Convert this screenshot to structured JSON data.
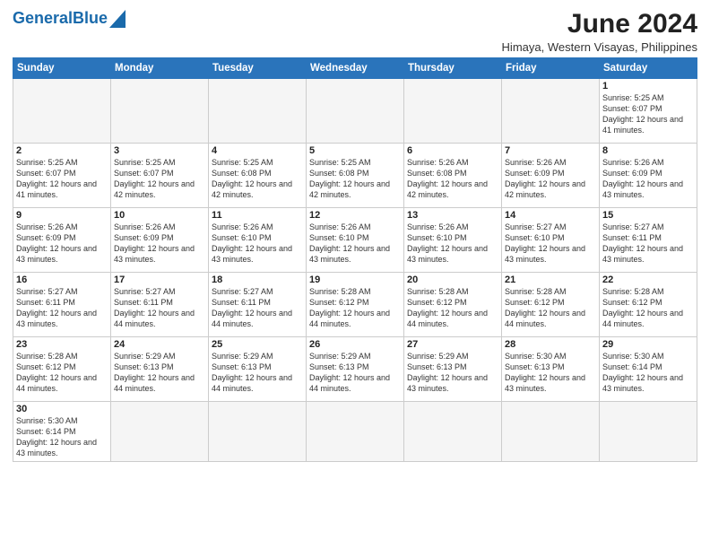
{
  "header": {
    "logo_general": "General",
    "logo_blue": "Blue",
    "title": "June 2024",
    "subtitle": "Himaya, Western Visayas, Philippines"
  },
  "weekdays": [
    "Sunday",
    "Monday",
    "Tuesday",
    "Wednesday",
    "Thursday",
    "Friday",
    "Saturday"
  ],
  "weeks": [
    [
      {
        "day": "",
        "empty": true
      },
      {
        "day": "",
        "empty": true
      },
      {
        "day": "",
        "empty": true
      },
      {
        "day": "",
        "empty": true
      },
      {
        "day": "",
        "empty": true
      },
      {
        "day": "",
        "empty": true
      },
      {
        "day": "1",
        "sunrise": "Sunrise: 5:25 AM",
        "sunset": "Sunset: 6:07 PM",
        "daylight": "Daylight: 12 hours and 41 minutes."
      }
    ],
    [
      {
        "day": "2",
        "sunrise": "Sunrise: 5:25 AM",
        "sunset": "Sunset: 6:07 PM",
        "daylight": "Daylight: 12 hours and 41 minutes."
      },
      {
        "day": "3",
        "sunrise": "Sunrise: 5:25 AM",
        "sunset": "Sunset: 6:07 PM",
        "daylight": "Daylight: 12 hours and 42 minutes."
      },
      {
        "day": "4",
        "sunrise": "Sunrise: 5:25 AM",
        "sunset": "Sunset: 6:08 PM",
        "daylight": "Daylight: 12 hours and 42 minutes."
      },
      {
        "day": "5",
        "sunrise": "Sunrise: 5:25 AM",
        "sunset": "Sunset: 6:08 PM",
        "daylight": "Daylight: 12 hours and 42 minutes."
      },
      {
        "day": "6",
        "sunrise": "Sunrise: 5:26 AM",
        "sunset": "Sunset: 6:08 PM",
        "daylight": "Daylight: 12 hours and 42 minutes."
      },
      {
        "day": "7",
        "sunrise": "Sunrise: 5:26 AM",
        "sunset": "Sunset: 6:09 PM",
        "daylight": "Daylight: 12 hours and 42 minutes."
      },
      {
        "day": "8",
        "sunrise": "Sunrise: 5:26 AM",
        "sunset": "Sunset: 6:09 PM",
        "daylight": "Daylight: 12 hours and 43 minutes."
      }
    ],
    [
      {
        "day": "9",
        "sunrise": "Sunrise: 5:26 AM",
        "sunset": "Sunset: 6:09 PM",
        "daylight": "Daylight: 12 hours and 43 minutes."
      },
      {
        "day": "10",
        "sunrise": "Sunrise: 5:26 AM",
        "sunset": "Sunset: 6:09 PM",
        "daylight": "Daylight: 12 hours and 43 minutes."
      },
      {
        "day": "11",
        "sunrise": "Sunrise: 5:26 AM",
        "sunset": "Sunset: 6:10 PM",
        "daylight": "Daylight: 12 hours and 43 minutes."
      },
      {
        "day": "12",
        "sunrise": "Sunrise: 5:26 AM",
        "sunset": "Sunset: 6:10 PM",
        "daylight": "Daylight: 12 hours and 43 minutes."
      },
      {
        "day": "13",
        "sunrise": "Sunrise: 5:26 AM",
        "sunset": "Sunset: 6:10 PM",
        "daylight": "Daylight: 12 hours and 43 minutes."
      },
      {
        "day": "14",
        "sunrise": "Sunrise: 5:27 AM",
        "sunset": "Sunset: 6:10 PM",
        "daylight": "Daylight: 12 hours and 43 minutes."
      },
      {
        "day": "15",
        "sunrise": "Sunrise: 5:27 AM",
        "sunset": "Sunset: 6:11 PM",
        "daylight": "Daylight: 12 hours and 43 minutes."
      }
    ],
    [
      {
        "day": "16",
        "sunrise": "Sunrise: 5:27 AM",
        "sunset": "Sunset: 6:11 PM",
        "daylight": "Daylight: 12 hours and 43 minutes."
      },
      {
        "day": "17",
        "sunrise": "Sunrise: 5:27 AM",
        "sunset": "Sunset: 6:11 PM",
        "daylight": "Daylight: 12 hours and 44 minutes."
      },
      {
        "day": "18",
        "sunrise": "Sunrise: 5:27 AM",
        "sunset": "Sunset: 6:11 PM",
        "daylight": "Daylight: 12 hours and 44 minutes."
      },
      {
        "day": "19",
        "sunrise": "Sunrise: 5:28 AM",
        "sunset": "Sunset: 6:12 PM",
        "daylight": "Daylight: 12 hours and 44 minutes."
      },
      {
        "day": "20",
        "sunrise": "Sunrise: 5:28 AM",
        "sunset": "Sunset: 6:12 PM",
        "daylight": "Daylight: 12 hours and 44 minutes."
      },
      {
        "day": "21",
        "sunrise": "Sunrise: 5:28 AM",
        "sunset": "Sunset: 6:12 PM",
        "daylight": "Daylight: 12 hours and 44 minutes."
      },
      {
        "day": "22",
        "sunrise": "Sunrise: 5:28 AM",
        "sunset": "Sunset: 6:12 PM",
        "daylight": "Daylight: 12 hours and 44 minutes."
      }
    ],
    [
      {
        "day": "23",
        "sunrise": "Sunrise: 5:28 AM",
        "sunset": "Sunset: 6:12 PM",
        "daylight": "Daylight: 12 hours and 44 minutes."
      },
      {
        "day": "24",
        "sunrise": "Sunrise: 5:29 AM",
        "sunset": "Sunset: 6:13 PM",
        "daylight": "Daylight: 12 hours and 44 minutes."
      },
      {
        "day": "25",
        "sunrise": "Sunrise: 5:29 AM",
        "sunset": "Sunset: 6:13 PM",
        "daylight": "Daylight: 12 hours and 44 minutes."
      },
      {
        "day": "26",
        "sunrise": "Sunrise: 5:29 AM",
        "sunset": "Sunset: 6:13 PM",
        "daylight": "Daylight: 12 hours and 44 minutes."
      },
      {
        "day": "27",
        "sunrise": "Sunrise: 5:29 AM",
        "sunset": "Sunset: 6:13 PM",
        "daylight": "Daylight: 12 hours and 43 minutes."
      },
      {
        "day": "28",
        "sunrise": "Sunrise: 5:30 AM",
        "sunset": "Sunset: 6:13 PM",
        "daylight": "Daylight: 12 hours and 43 minutes."
      },
      {
        "day": "29",
        "sunrise": "Sunrise: 5:30 AM",
        "sunset": "Sunset: 6:14 PM",
        "daylight": "Daylight: 12 hours and 43 minutes."
      }
    ],
    [
      {
        "day": "30",
        "sunrise": "Sunrise: 5:30 AM",
        "sunset": "Sunset: 6:14 PM",
        "daylight": "Daylight: 12 hours and 43 minutes."
      },
      {
        "day": "",
        "empty": true
      },
      {
        "day": "",
        "empty": true
      },
      {
        "day": "",
        "empty": true
      },
      {
        "day": "",
        "empty": true
      },
      {
        "day": "",
        "empty": true
      },
      {
        "day": "",
        "empty": true
      }
    ]
  ]
}
